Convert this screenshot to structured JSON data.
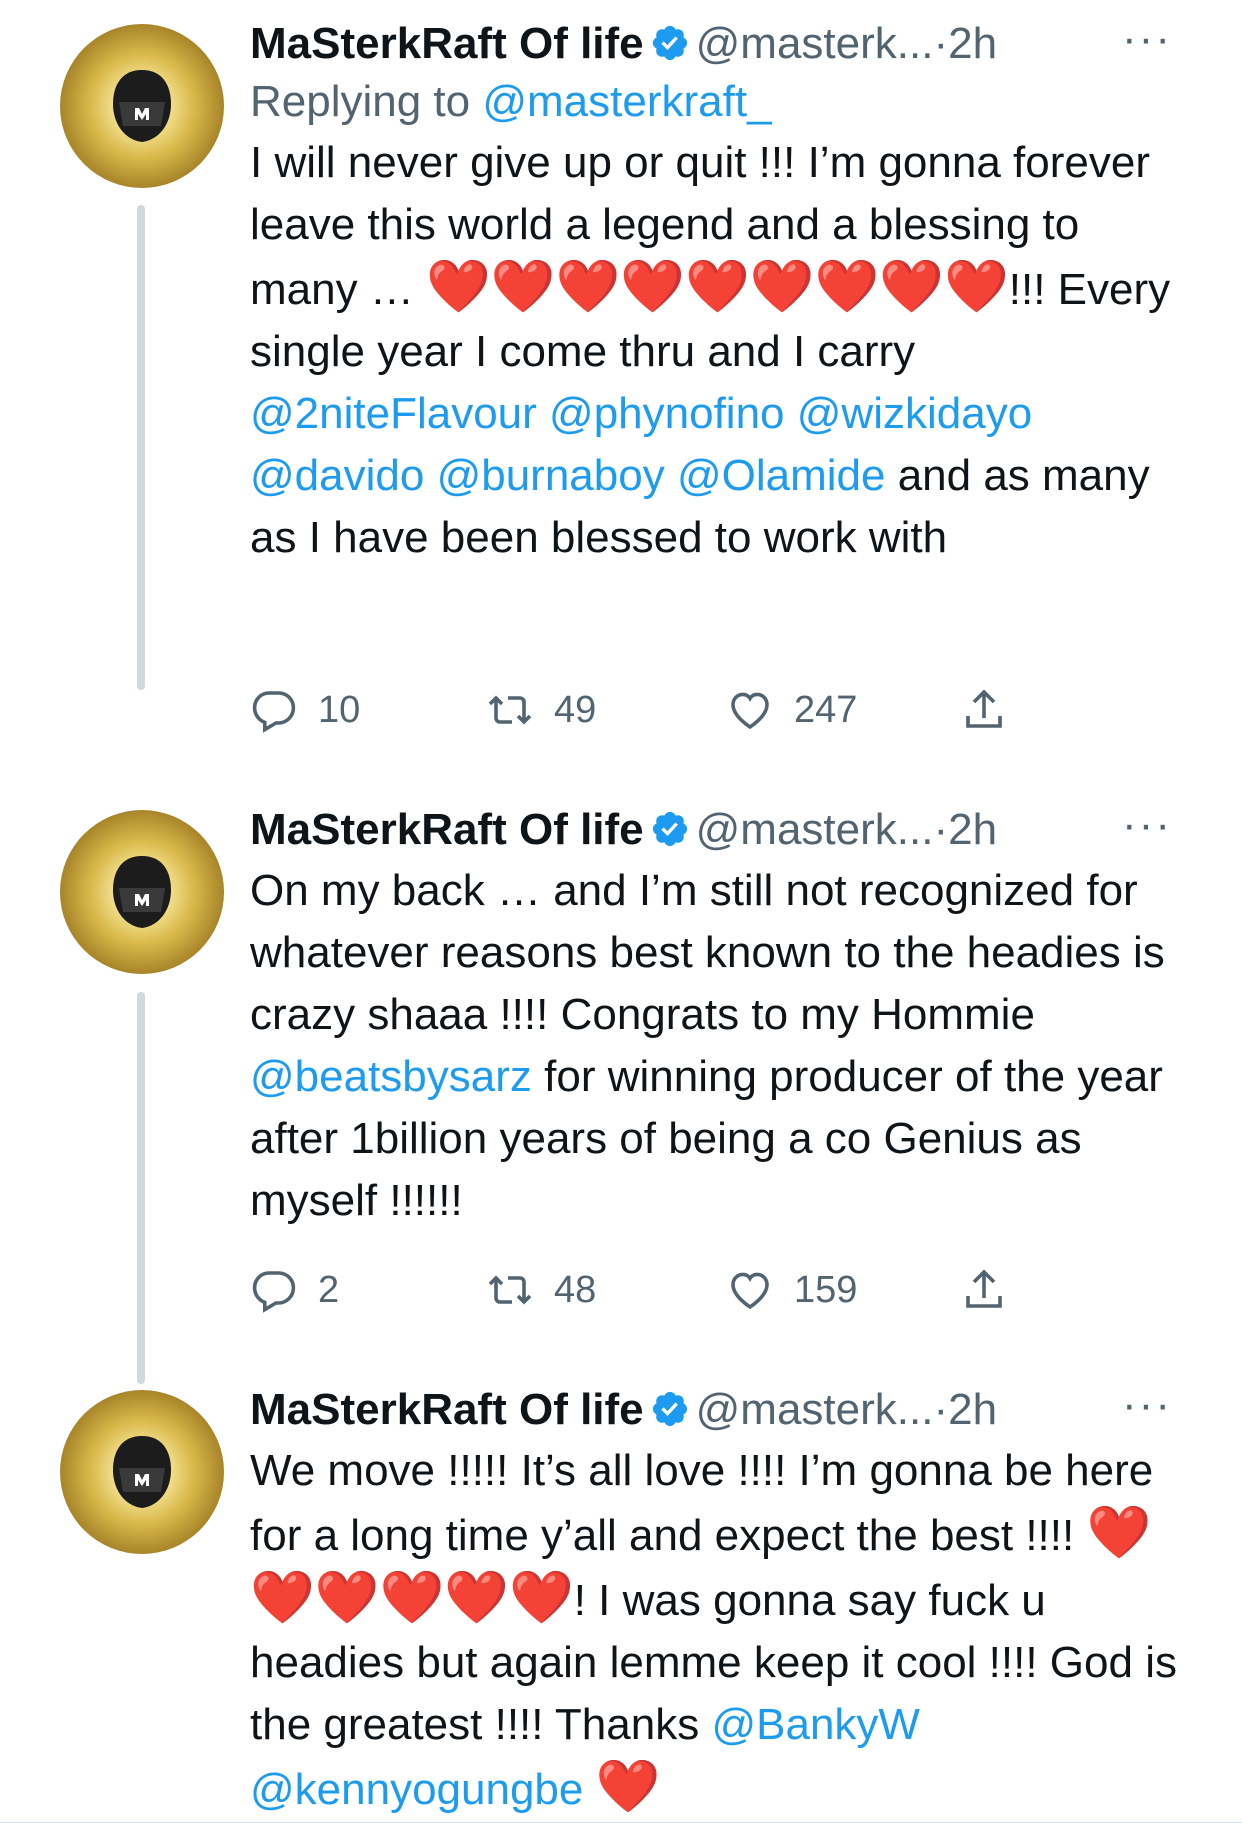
{
  "tweets": [
    {
      "name": "MaSterkRaft Of life",
      "handle": "@masterk...",
      "dot": "·",
      "time": "2h",
      "more": "···",
      "replying_prefix": "Replying to ",
      "replying_to": "@masterkraft_",
      "body": {
        "t1": "I will never give up or quit !!! I’m gonna forever leave this world a legend and a blessing to many … ",
        "hearts1": "❤️❤️❤️❤️❤️❤️❤️❤️❤️",
        "t2": "!!! Every single year I come thru and I carry ",
        "m1": "@2niteFlavour",
        "m2": "@phynofino",
        "m3": "@wizkidayo",
        "m4": "@davido",
        "m5": "@burnaboy",
        "m6": "@Olamide",
        "t3": " and as many as I have been blessed to work with"
      },
      "replies": "10",
      "retweets": "49",
      "likes": "247"
    },
    {
      "name": "MaSterkRaft Of life",
      "handle": "@masterk...",
      "dot": "·",
      "time": "2h",
      "more": "···",
      "body": {
        "t1": "On my back … and I’m still not recognized for whatever reasons best known to the headies is crazy shaaa !!!! Congrats to my Hommie ",
        "m1": "@beatsbysarz",
        "t2": " for winning producer of the year after 1billion years of being a co Genius as myself !!!!!!"
      },
      "replies": "2",
      "retweets": "48",
      "likes": "159"
    },
    {
      "name": "MaSterkRaft Of life",
      "handle": "@masterk...",
      "dot": "·",
      "time": "2h",
      "more": "···",
      "body": {
        "t1": "We move !!!!! It’s all love !!!! I’m gonna be here for a long time y’all and expect the best !!!! ",
        "hearts1": "❤️❤️❤️❤️❤️❤️",
        "t2": "! I was gonna say fuck u headies but again lemme keep it cool !!!! God is the greatest !!!! Thanks ",
        "m1": "@BankyW",
        "m2": "@kennyogungbe",
        "hearts2": "❤️"
      }
    }
  ],
  "colors": {
    "accent": "#1d9bf0",
    "secondary_text": "#536471",
    "heart": "#e0101e",
    "thread_line": "#cfd9de"
  },
  "icons": [
    "verified-badge-icon",
    "more-icon",
    "reply-icon",
    "retweet-icon",
    "like-icon",
    "share-icon",
    "avatar-helmet-icon"
  ]
}
